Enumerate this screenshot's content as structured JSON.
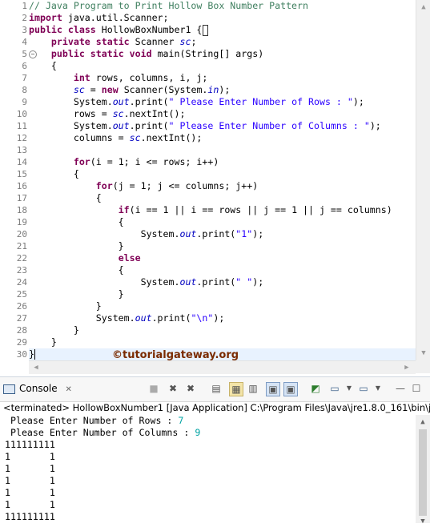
{
  "editor": {
    "lines": [
      {
        "n": "1",
        "parts": [
          [
            "cm",
            "// Java Program to Print Hollow Box Number Pattern"
          ]
        ]
      },
      {
        "n": "2",
        "parts": [
          [
            "kw",
            "import"
          ],
          [
            "v",
            " java.util.Scanner;"
          ]
        ]
      },
      {
        "n": "3",
        "parts": [
          [
            "kw",
            "public"
          ],
          [
            "v",
            " "
          ],
          [
            "kw",
            "class"
          ],
          [
            "v",
            " HollowBoxNumber1 {"
          ]
        ]
      },
      {
        "n": "4",
        "parts": [
          [
            "v",
            "    "
          ],
          [
            "kw",
            "private"
          ],
          [
            "v",
            " "
          ],
          [
            "kw",
            "static"
          ],
          [
            "v",
            " Scanner "
          ],
          [
            "fd",
            "sc"
          ],
          [
            "v",
            ";"
          ]
        ]
      },
      {
        "n": "5",
        "parts": [
          [
            "v",
            "    "
          ],
          [
            "kw",
            "public"
          ],
          [
            "v",
            " "
          ],
          [
            "kw",
            "static"
          ],
          [
            "v",
            " "
          ],
          [
            "kw",
            "void"
          ],
          [
            "v",
            " main(String[] args)"
          ]
        ]
      },
      {
        "n": "6",
        "parts": [
          [
            "v",
            "    {"
          ]
        ]
      },
      {
        "n": "7",
        "parts": [
          [
            "v",
            "        "
          ],
          [
            "kw",
            "int"
          ],
          [
            "v",
            " rows, columns, i, j;"
          ]
        ]
      },
      {
        "n": "8",
        "parts": [
          [
            "v",
            "        "
          ],
          [
            "fd",
            "sc"
          ],
          [
            "v",
            " = "
          ],
          [
            "kw",
            "new"
          ],
          [
            "v",
            " Scanner(System."
          ],
          [
            "fd",
            "in"
          ],
          [
            "v",
            ");"
          ]
        ]
      },
      {
        "n": "9",
        "parts": [
          [
            "v",
            "        System."
          ],
          [
            "fd",
            "out"
          ],
          [
            "v",
            ".print("
          ],
          [
            "st",
            "\" Please Enter Number of Rows : \""
          ],
          [
            "v",
            ");"
          ]
        ]
      },
      {
        "n": "10",
        "parts": [
          [
            "v",
            "        rows = "
          ],
          [
            "fd",
            "sc"
          ],
          [
            "v",
            ".nextInt();"
          ]
        ]
      },
      {
        "n": "11",
        "parts": [
          [
            "v",
            "        System."
          ],
          [
            "fd",
            "out"
          ],
          [
            "v",
            ".print("
          ],
          [
            "st",
            "\" Please Enter Number of Columns : \""
          ],
          [
            "v",
            ");"
          ]
        ]
      },
      {
        "n": "12",
        "parts": [
          [
            "v",
            "        columns = "
          ],
          [
            "fd",
            "sc"
          ],
          [
            "v",
            ".nextInt();"
          ]
        ]
      },
      {
        "n": "13",
        "parts": [
          [
            "v",
            ""
          ]
        ]
      },
      {
        "n": "14",
        "parts": [
          [
            "v",
            "        "
          ],
          [
            "kw",
            "for"
          ],
          [
            "v",
            "(i = 1; i <= rows; i++)"
          ]
        ]
      },
      {
        "n": "15",
        "parts": [
          [
            "v",
            "        {"
          ]
        ]
      },
      {
        "n": "16",
        "parts": [
          [
            "v",
            "            "
          ],
          [
            "kw",
            "for"
          ],
          [
            "v",
            "(j = 1; j <= columns; j++)"
          ]
        ]
      },
      {
        "n": "17",
        "parts": [
          [
            "v",
            "            {"
          ]
        ]
      },
      {
        "n": "18",
        "parts": [
          [
            "v",
            "                "
          ],
          [
            "kw",
            "if"
          ],
          [
            "v",
            "(i == 1 || i == rows || j == 1 || j == columns)"
          ]
        ]
      },
      {
        "n": "19",
        "parts": [
          [
            "v",
            "                {"
          ]
        ]
      },
      {
        "n": "20",
        "parts": [
          [
            "v",
            "                    System."
          ],
          [
            "fd",
            "out"
          ],
          [
            "v",
            ".print("
          ],
          [
            "st",
            "\"1\""
          ],
          [
            "v",
            ");"
          ]
        ]
      },
      {
        "n": "21",
        "parts": [
          [
            "v",
            "                }"
          ]
        ]
      },
      {
        "n": "22",
        "parts": [
          [
            "v",
            "                "
          ],
          [
            "kw",
            "else"
          ]
        ]
      },
      {
        "n": "23",
        "parts": [
          [
            "v",
            "                {"
          ]
        ]
      },
      {
        "n": "24",
        "parts": [
          [
            "v",
            "                    System."
          ],
          [
            "fd",
            "out"
          ],
          [
            "v",
            ".print("
          ],
          [
            "st",
            "\" \""
          ],
          [
            "v",
            ");"
          ]
        ]
      },
      {
        "n": "25",
        "parts": [
          [
            "v",
            "                }"
          ]
        ]
      },
      {
        "n": "26",
        "parts": [
          [
            "v",
            "            }"
          ]
        ]
      },
      {
        "n": "27",
        "parts": [
          [
            "v",
            "            System."
          ],
          [
            "fd",
            "out"
          ],
          [
            "v",
            ".print("
          ],
          [
            "st",
            "\"\\n\""
          ],
          [
            "v",
            ");"
          ]
        ]
      },
      {
        "n": "28",
        "parts": [
          [
            "v",
            "        }"
          ]
        ]
      },
      {
        "n": "29",
        "parts": [
          [
            "v",
            "    }"
          ]
        ]
      },
      {
        "n": "30",
        "parts": [
          [
            "v",
            "}"
          ]
        ]
      }
    ],
    "watermark": "©tutorialgateway.org"
  },
  "console": {
    "tab_label": "Console",
    "close_glyph": "✕",
    "status": "<terminated> HollowBoxNumber1 [Java Application] C:\\Program Files\\Java\\jre1.8.0_161\\bin\\javaw.e",
    "output": [
      {
        "text": " Please Enter Number of Rows : ",
        "input": "7"
      },
      {
        "text": " Please Enter Number of Columns : ",
        "input": "9"
      },
      {
        "text": "111111111",
        "input": ""
      },
      {
        "text": "1       1",
        "input": ""
      },
      {
        "text": "1       1",
        "input": ""
      },
      {
        "text": "1       1",
        "input": ""
      },
      {
        "text": "1       1",
        "input": ""
      },
      {
        "text": "1       1",
        "input": ""
      },
      {
        "text": "111111111",
        "input": ""
      }
    ],
    "toolbar_icons": [
      "terminate-icon",
      "remove-launch-icon",
      "remove-all-icon",
      "scroll-lock-icon",
      "word-wrap-icon",
      "show-on-output-icon",
      "show-on-error-icon",
      "pin-console-icon",
      "display-selected-console-icon",
      "open-console-icon",
      "minimize-icon",
      "maximize-icon"
    ]
  }
}
